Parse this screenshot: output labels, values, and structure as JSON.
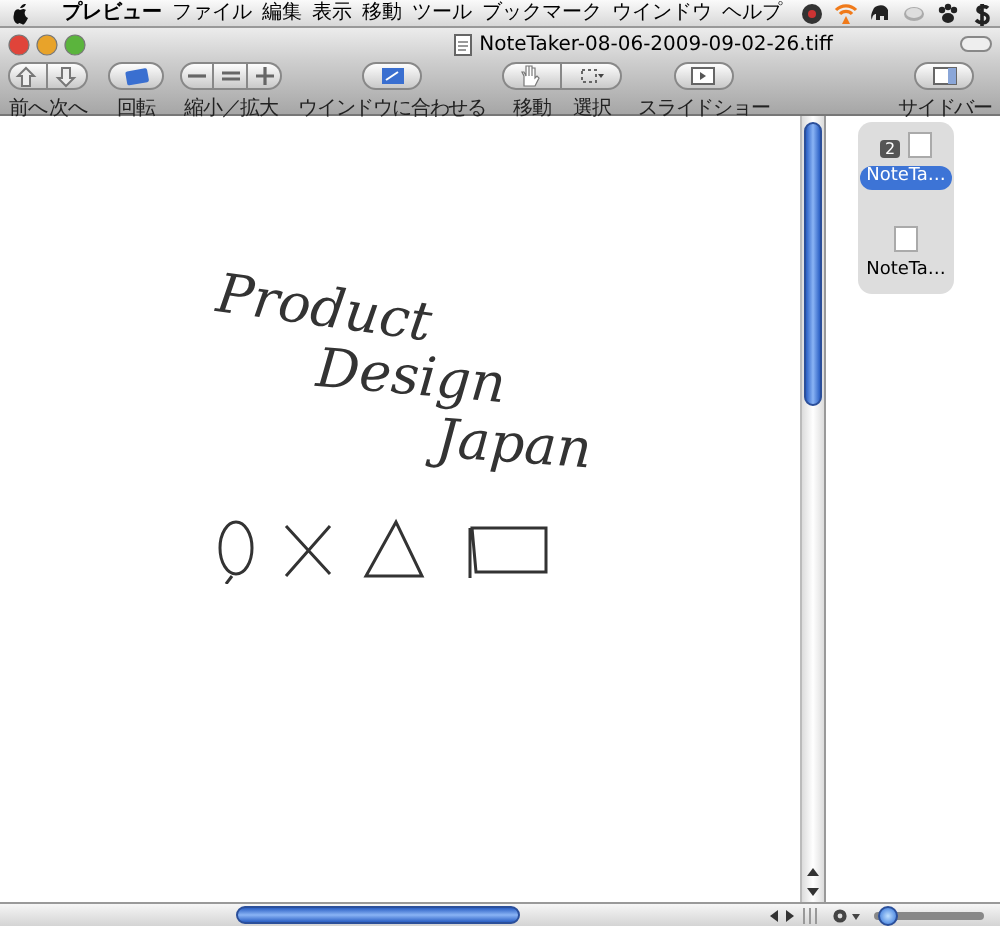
{
  "menubar": {
    "items": [
      "プレビュー",
      "ファイル",
      "編集",
      "表示",
      "移動",
      "ツール",
      "ブックマーク",
      "ウインドウ",
      "ヘルプ"
    ]
  },
  "window": {
    "title": "NoteTaker-08-06-2009-09-02-26.tiff"
  },
  "toolbar": {
    "items": [
      {
        "kind": "segmented",
        "segments": [
          "前へ",
          "次へ"
        ]
      },
      {
        "kind": "button",
        "label": "回転"
      },
      {
        "kind": "zoom",
        "label": "縮小／拡大"
      },
      {
        "kind": "button",
        "label": "ウインドウに合わせる"
      },
      {
        "kind": "segmented",
        "segments": [
          "移動",
          "選択"
        ]
      },
      {
        "kind": "button",
        "label": "スライドショー"
      },
      {
        "kind": "spacer"
      },
      {
        "kind": "button",
        "label": "サイドバー"
      }
    ]
  },
  "document": {
    "lines": [
      "Product",
      "Design",
      "Japan"
    ]
  },
  "sidebar": {
    "thumbnails": [
      {
        "label": "NoteTa…",
        "selected": true,
        "badge": "2"
      },
      {
        "label": "NoteTa…",
        "selected": false
      }
    ],
    "zoom_slider": {
      "level": 0.05
    }
  }
}
